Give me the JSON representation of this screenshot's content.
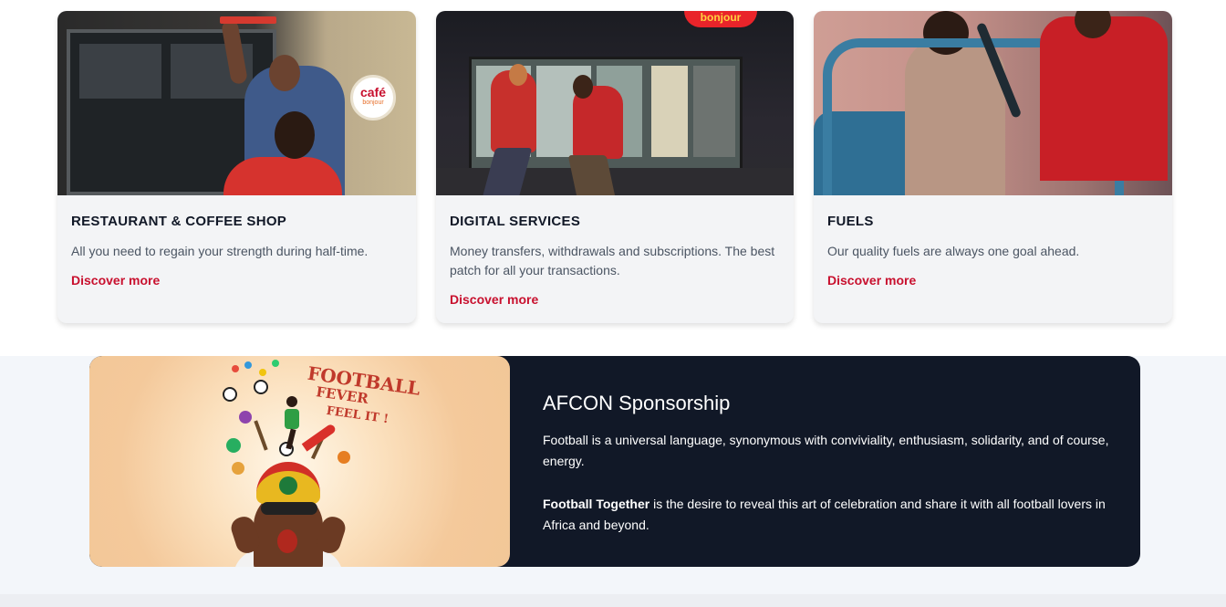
{
  "cards": [
    {
      "title": "RESTAURANT & COFFEE SHOP",
      "description": "All you need to regain your strength during half-time.",
      "link": "Discover more",
      "image_logo_text": "café",
      "image_logo_sub": "bonjour"
    },
    {
      "title": "DIGITAL SERVICES",
      "description": "Money transfers, withdrawals and subscriptions. The best patch for all your transactions.",
      "link": "Discover more",
      "image_sign": "bonjour"
    },
    {
      "title": "FUELS",
      "description": "Our quality fuels are always one goal ahead.",
      "link": "Discover more"
    }
  ],
  "sponsorship": {
    "title": "AFCON Sponsorship",
    "paragraph1": "Football is a universal language, synonymous with conviviality, enthusiasm, solidarity, and of course, energy.",
    "paragraph2_bold": "Football Together",
    "paragraph2_rest": " is the desire to reveal this art of celebration and share it with all football lovers in Africa and beyond.",
    "image_text": {
      "line1": "FOOTBALL",
      "line2": "FEVER",
      "line3": "FEEL IT !"
    }
  },
  "colors": {
    "accent": "#c8102e",
    "panel_dark": "#111827",
    "card_bg": "#f3f4f6",
    "band_bg": "#f3f6fa"
  }
}
